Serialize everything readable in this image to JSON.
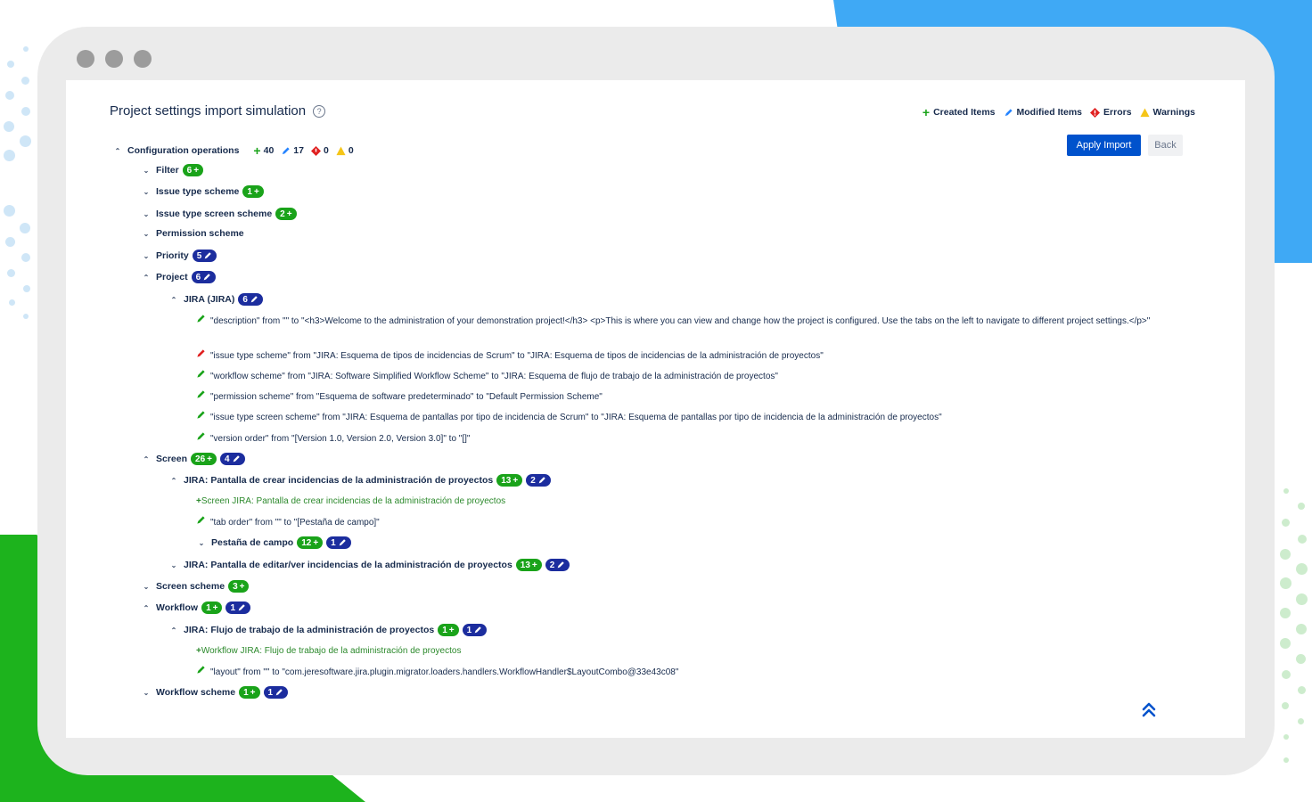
{
  "window": {
    "title": "Project settings import simulation"
  },
  "legend": {
    "created": "Created Items",
    "modified": "Modified Items",
    "errors": "Errors",
    "warnings": "Warnings"
  },
  "actions": {
    "apply": "Apply Import",
    "back": "Back"
  },
  "summary": {
    "label": "Configuration operations",
    "created": "40",
    "modified": "17",
    "errors": "0",
    "warnings": "0"
  },
  "tree": {
    "filter": {
      "label": "Filter",
      "created": "6"
    },
    "issue_type_scheme": {
      "label": "Issue type scheme",
      "created": "1"
    },
    "issue_type_screen_scheme": {
      "label": "Issue type screen scheme",
      "created": "2"
    },
    "permission_scheme": {
      "label": "Permission scheme"
    },
    "priority": {
      "label": "Priority",
      "modified": "5"
    },
    "project": {
      "label": "Project",
      "modified": "6"
    },
    "jira_project": {
      "label": "JIRA (JIRA)",
      "modified": "6"
    },
    "project_changes": [
      "\"description\" from \"\" to \"<h3>Welcome to the administration of your demonstration project!</h3> <p>This is where you can view and change how the project is configured. Use the tabs on the left to navigate to different project settings.</p>\"",
      "\"issue type scheme\" from \"JIRA: Esquema de tipos de incidencias de Scrum\" to \"JIRA: Esquema de tipos de incidencias de la administración de proyectos\"",
      "\"workflow scheme\" from \"JIRA: Software Simplified Workflow Scheme\" to \"JIRA: Esquema de flujo de trabajo de la administración de proyectos\"",
      "\"permission scheme\" from \"Esquema de software predeterminado\" to \"Default Permission Scheme\"",
      "\"issue type screen scheme\" from \"JIRA: Esquema de pantallas por tipo de incidencia de Scrum\" to \"JIRA: Esquema de pantallas por tipo de incidencia de la administración de proyectos\"",
      "\"version order\" from \"[Version 1.0, Version 2.0, Version 3.0]\" to \"[]\""
    ],
    "screen": {
      "label": "Screen",
      "created": "26",
      "modified": "4"
    },
    "screen_create": {
      "label": "JIRA: Pantalla de crear incidencias de la administración de proyectos",
      "created": "13",
      "modified": "2"
    },
    "screen_create_item": "Screen JIRA: Pantalla de crear incidencias de la administración de proyectos",
    "screen_create_change": "\"tab order\" from \"\" to \"[Pestaña de campo]\"",
    "tab_field": {
      "label": "Pestaña de campo",
      "created": "12",
      "modified": "1"
    },
    "screen_edit": {
      "label": "JIRA: Pantalla de editar/ver incidencias de la administración de proyectos",
      "created": "13",
      "modified": "2"
    },
    "screen_scheme": {
      "label": "Screen scheme",
      "created": "3"
    },
    "workflow": {
      "label": "Workflow",
      "created": "1",
      "modified": "1"
    },
    "workflow_jira": {
      "label": "JIRA: Flujo de trabajo de la administración de proyectos",
      "created": "1",
      "modified": "1"
    },
    "workflow_item": "Workflow JIRA: Flujo de trabajo de la administración de proyectos",
    "workflow_change": "\"layout\" from \"\" to \"com.jeresoftware.jira.plugin.migrator.loaders.handlers.WorkflowHandler$LayoutCombo@33e43c08\"",
    "workflow_scheme": {
      "label": "Workflow scheme",
      "created": "1",
      "modified": "1"
    }
  },
  "colors": {
    "created": "#1aa31a",
    "modified": "#1c2d9e",
    "error": "#e02020",
    "warning": "#f5c518",
    "primary": "#0052cc"
  }
}
